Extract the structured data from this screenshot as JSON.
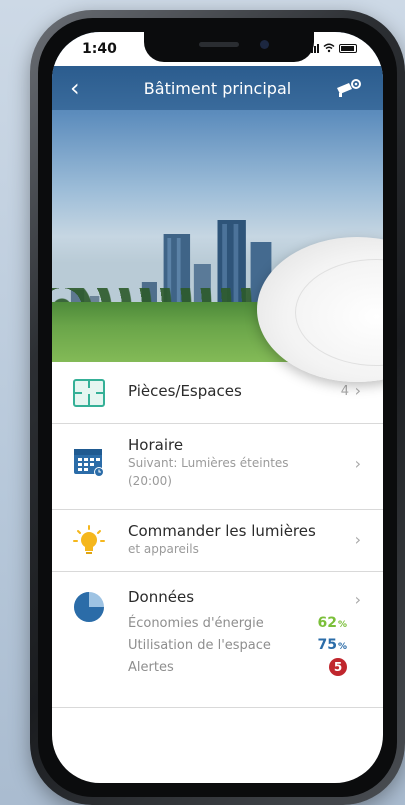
{
  "status_bar": {
    "time": "1:40",
    "signal_icon": "signal-icon",
    "wifi_icon": "wifi-icon",
    "battery_icon": "battery-icon"
  },
  "nav": {
    "back_label": "‹",
    "title": "Bâtiment principal",
    "settings_icon": "camera-settings-icon"
  },
  "list": {
    "rooms": {
      "title": "Pièces/Espaces",
      "count": "4",
      "chevron": "›",
      "icon": "floorplan-icon"
    },
    "schedule": {
      "title": "Horaire",
      "subtitle": "Suivant: Lumières éteintes (20:00)",
      "chevron": "›",
      "icon": "calendar-icon"
    },
    "lights": {
      "title": "Commander les lumières",
      "subtitle": "et appareils",
      "chevron": "›",
      "icon": "lightbulb-icon"
    },
    "data": {
      "title": "Données",
      "chevron": "›",
      "icon": "pie-chart-icon",
      "metrics": [
        {
          "label": "Économies d'énergie",
          "value": "62",
          "unit": "%",
          "color": "#7bbf3a"
        },
        {
          "label": "Utilisation de l'espace",
          "value": "75",
          "unit": "%",
          "color": "#2b6ca8"
        },
        {
          "label": "Alertes",
          "value": "5",
          "color": "#c0262d"
        }
      ]
    }
  },
  "colors": {
    "nav_bg": "#2b5c8e",
    "accent_green": "#7bbf3a",
    "accent_blue": "#2b6ca8",
    "alert_red": "#c0262d"
  }
}
